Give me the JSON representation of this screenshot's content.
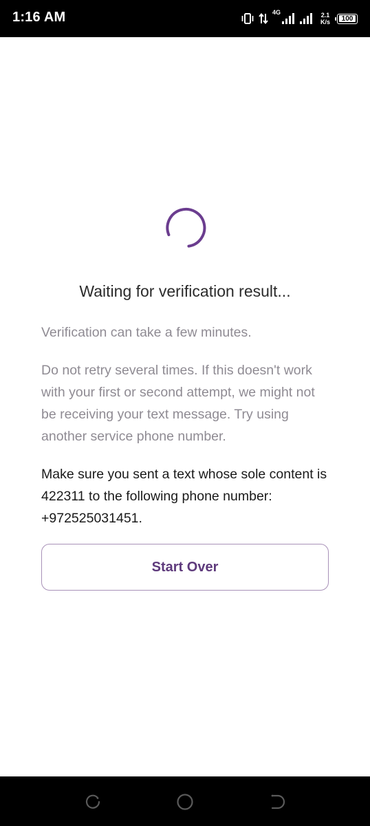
{
  "status_bar": {
    "time": "1:16 AM",
    "network_type": "4G",
    "speed_value": "2.1",
    "speed_unit": "K/s",
    "battery_level": "100",
    "battery_fraction": 1.0
  },
  "verification": {
    "title": "Waiting for verification result...",
    "info_time": "Verification can take a few minutes.",
    "info_retry": "Do not retry several times. If this doesn't work with your first or second attempt, we might not be receiving your text message. Try using another service phone number.",
    "instruction": "Make sure you sent a text whose sole content is 422311 to the following phone number: +972525031451.",
    "start_over_label": "Start Over"
  },
  "colors": {
    "accent": "#6b3d8f",
    "muted_text": "#8f8b93",
    "button_border": "#a891b8",
    "button_text": "#5e3a7c"
  },
  "icons": {
    "spinner": "loading-spinner-icon",
    "vibrate": "vibrate-icon",
    "data_arrows": "data-transfer-icon",
    "signal": "signal-icon",
    "battery": "battery-icon",
    "nav_recents": "recents-icon",
    "nav_home": "home-icon",
    "nav_back": "back-icon"
  }
}
